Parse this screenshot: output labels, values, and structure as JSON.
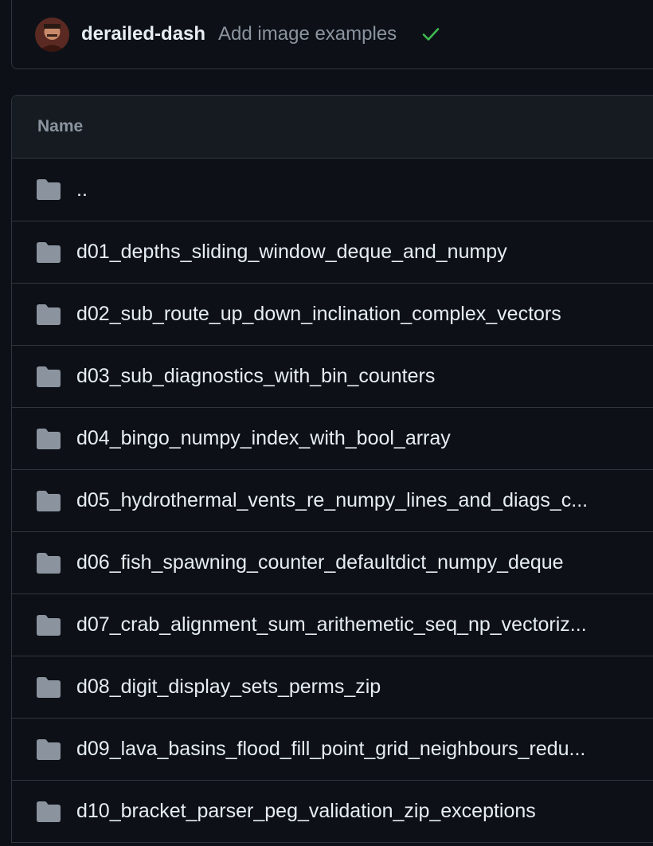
{
  "commit": {
    "author": "derailed-dash",
    "message": "Add image examples",
    "status_icon": "check-icon",
    "status_color": "#3fb950"
  },
  "table": {
    "header_name": "Name",
    "rows": [
      {
        "icon": "folder-icon",
        "name": ".."
      },
      {
        "icon": "folder-icon",
        "name": "d01_depths_sliding_window_deque_and_numpy"
      },
      {
        "icon": "folder-icon",
        "name": "d02_sub_route_up_down_inclination_complex_vectors"
      },
      {
        "icon": "folder-icon",
        "name": "d03_sub_diagnostics_with_bin_counters"
      },
      {
        "icon": "folder-icon",
        "name": "d04_bingo_numpy_index_with_bool_array"
      },
      {
        "icon": "folder-icon",
        "name": "d05_hydrothermal_vents_re_numpy_lines_and_diags_c..."
      },
      {
        "icon": "folder-icon",
        "name": "d06_fish_spawning_counter_defaultdict_numpy_deque"
      },
      {
        "icon": "folder-icon",
        "name": "d07_crab_alignment_sum_arithemetic_seq_np_vectoriz..."
      },
      {
        "icon": "folder-icon",
        "name": "d08_digit_display_sets_perms_zip"
      },
      {
        "icon": "folder-icon",
        "name": "d09_lava_basins_flood_fill_point_grid_neighbours_redu..."
      },
      {
        "icon": "folder-icon",
        "name": "d10_bracket_parser_peg_validation_zip_exceptions"
      }
    ]
  },
  "colors": {
    "background": "#0d1117",
    "border": "#30363d",
    "header_bg": "#161b22",
    "folder": "#8b949e",
    "muted_text": "#8b949e"
  }
}
